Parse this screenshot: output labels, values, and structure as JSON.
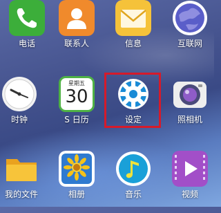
{
  "apps": [
    {
      "id": "phone",
      "label": "电话",
      "icon": "phone-icon"
    },
    {
      "id": "contacts",
      "label": "联系人",
      "icon": "contacts-icon"
    },
    {
      "id": "messages",
      "label": "信息",
      "icon": "messages-icon"
    },
    {
      "id": "internet",
      "label": "互联网",
      "icon": "internet-icon"
    },
    {
      "id": "clock",
      "label": "时钟",
      "icon": "clock-icon"
    },
    {
      "id": "calendar",
      "label": "S 日历",
      "icon": "calendar-icon",
      "header": "星期五",
      "day": "30"
    },
    {
      "id": "settings",
      "label": "设定",
      "icon": "gear-icon",
      "highlighted": true,
      "highlight_color": "#d61a2a"
    },
    {
      "id": "camera",
      "label": "照相机",
      "icon": "camera-icon"
    },
    {
      "id": "files",
      "label": "我的文件",
      "icon": "folder-icon"
    },
    {
      "id": "gallery",
      "label": "相册",
      "icon": "gallery-icon"
    },
    {
      "id": "music",
      "label": "音乐",
      "icon": "music-icon"
    },
    {
      "id": "video",
      "label": "视频",
      "icon": "video-icon"
    }
  ],
  "colors": {
    "phone": "#3cae3a",
    "contacts": "#f08a2c",
    "messages": "#f5c23a",
    "settings": "#1a8bd6",
    "music": "#1aa0d8",
    "video": "#a24fc8",
    "highlight": "#d61a2a"
  }
}
